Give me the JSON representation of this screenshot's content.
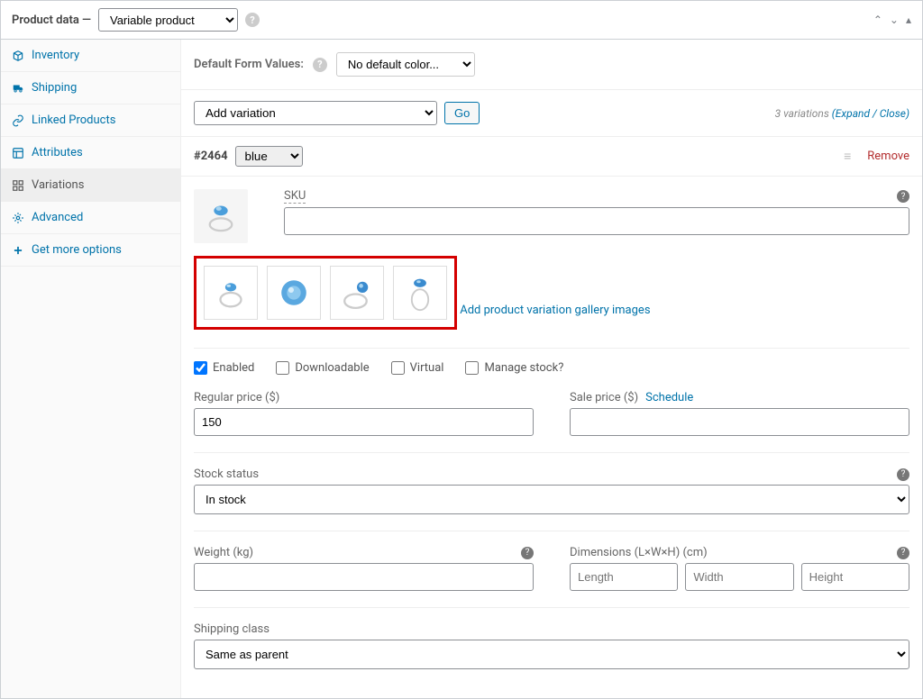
{
  "header": {
    "title": "Product data —",
    "product_type": "Variable product"
  },
  "sidebar": {
    "items": [
      {
        "label": "Inventory"
      },
      {
        "label": "Shipping"
      },
      {
        "label": "Linked Products"
      },
      {
        "label": "Attributes"
      },
      {
        "label": "Variations"
      },
      {
        "label": "Advanced"
      },
      {
        "label": "Get more options"
      }
    ]
  },
  "toolbar": {
    "default_form_label": "Default Form Values:",
    "default_form_value": "No default color...",
    "add_variation_label": "Add variation",
    "go_label": "Go",
    "variations_count_prefix": "3 variations",
    "expand_close": "(Expand / Close)"
  },
  "variation": {
    "id": "#2464",
    "color_option": "blue",
    "remove_label": "Remove",
    "sku_label": "SKU",
    "sku_value": "",
    "add_gallery_label": "Add product variation gallery images",
    "checkboxes": {
      "enabled": "Enabled",
      "downloadable": "Downloadable",
      "virtual": "Virtual",
      "manage_stock": "Manage stock?"
    },
    "pricing": {
      "regular_label": "Regular price ($)",
      "regular_value": "150",
      "sale_label": "Sale price ($)",
      "sale_value": "",
      "schedule_label": "Schedule"
    },
    "stock": {
      "label": "Stock status",
      "value": "In stock"
    },
    "weight": {
      "label": "Weight (kg)",
      "value": ""
    },
    "dimensions": {
      "label": "Dimensions (L×W×H) (cm)",
      "length_placeholder": "Length",
      "width_placeholder": "Width",
      "height_placeholder": "Height"
    },
    "shipping_class": {
      "label": "Shipping class",
      "value": "Same as parent"
    }
  }
}
